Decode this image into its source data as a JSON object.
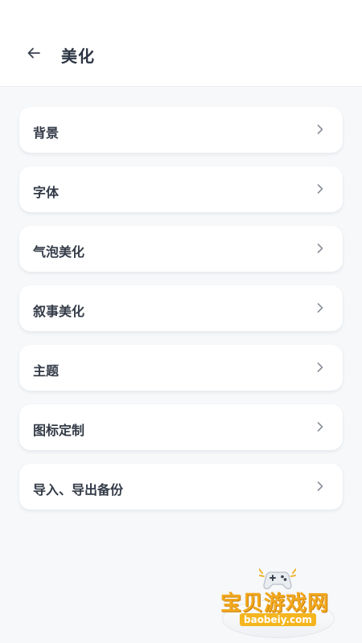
{
  "header": {
    "title": "美化",
    "back_icon": "arrow-left-icon"
  },
  "menu": {
    "items": [
      {
        "label": "背景",
        "icon": "chevron-right-icon"
      },
      {
        "label": "字体",
        "icon": "chevron-right-icon"
      },
      {
        "label": "气泡美化",
        "icon": "chevron-right-icon"
      },
      {
        "label": "叙事美化",
        "icon": "chevron-right-icon"
      },
      {
        "label": "主题",
        "icon": "chevron-right-icon"
      },
      {
        "label": "图标定制",
        "icon": "chevron-right-icon"
      },
      {
        "label": "导入、导出备份",
        "icon": "chevron-right-icon"
      }
    ]
  },
  "watermark": {
    "text": "宝贝游戏网",
    "url": "baobeiy.com"
  },
  "colors": {
    "background": "#f6f8fa",
    "card": "#ffffff",
    "title_text": "#2b3442",
    "chevron": "#8a9099",
    "watermark_orange": "#f2a81d"
  }
}
